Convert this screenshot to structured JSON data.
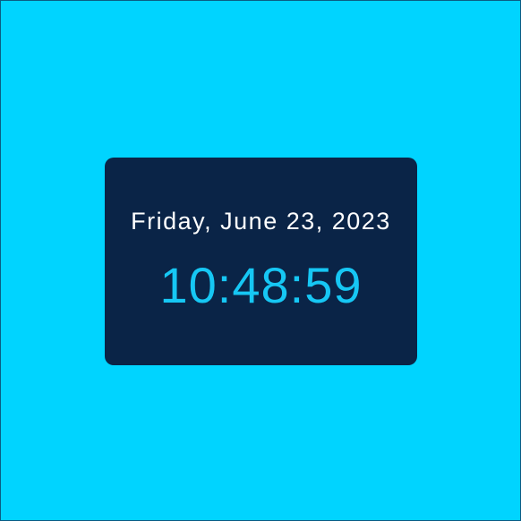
{
  "colors": {
    "background": "#00d4ff",
    "card": "#0a2447",
    "date_text": "#ffffff",
    "time_text": "#16c7f4"
  },
  "clock": {
    "date": "Friday, June 23, 2023",
    "time": "10:48:59"
  }
}
